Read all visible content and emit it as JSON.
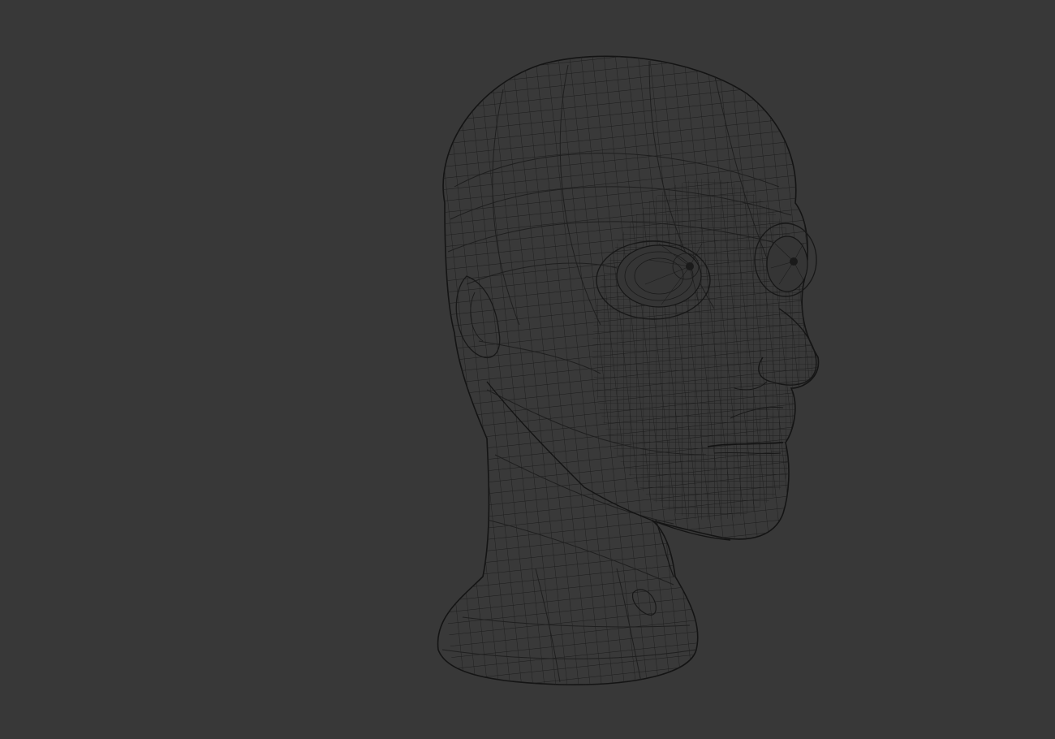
{
  "viewport": {
    "background": "#383838",
    "mesh": {
      "object": "head-bust",
      "display_mode": "wireframe",
      "wire_color": "#1e1e1e",
      "surface_color": "#383838"
    }
  }
}
